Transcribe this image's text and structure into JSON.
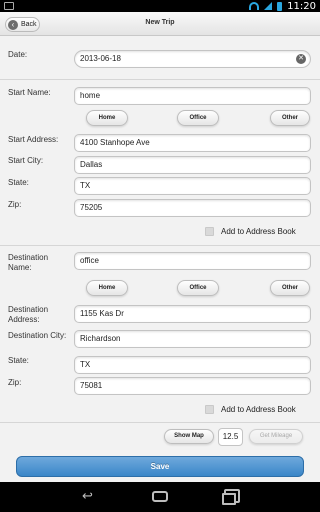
{
  "status_bar": {
    "time": "11:20"
  },
  "header": {
    "title": "New Trip",
    "back_label": "Back"
  },
  "date": {
    "label": "Date:",
    "value": "2013-06-18"
  },
  "start": {
    "name_label": "Start Name:",
    "name_value": "home",
    "quick_buttons": [
      "Home",
      "Office",
      "Other"
    ],
    "address_label": "Start Address:",
    "address_value": "4100 Stanhope Ave",
    "city_label": "Start City:",
    "city_value": "Dallas",
    "state_label": "State:",
    "state_value": "TX",
    "zip_label": "Zip:",
    "zip_value": "75205",
    "add_to_book_label": "Add to Address Book"
  },
  "destination": {
    "name_label": "Destination Name:",
    "name_value": "office",
    "quick_buttons": [
      "Home",
      "Office",
      "Other"
    ],
    "address_label": "Destination Address:",
    "address_value": "1155 Kas Dr",
    "city_label": "Destination City:",
    "city_value": "Richardson",
    "state_label": "State:",
    "state_value": "TX",
    "zip_label": "Zip:",
    "zip_value": "75081",
    "add_to_book_label": "Add to Address Book"
  },
  "footer": {
    "show_map_label": "Show Map",
    "mileage_value": "12.5",
    "get_mileage_label": "Get Mileage",
    "save_label": "Save"
  }
}
